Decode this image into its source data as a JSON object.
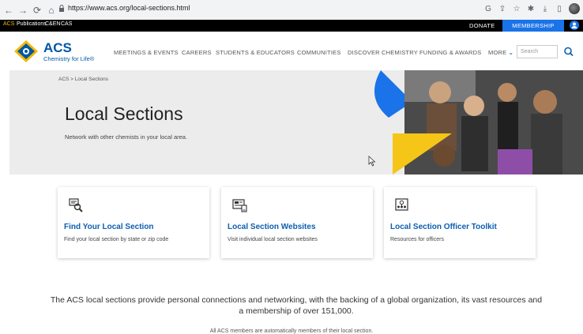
{
  "browser": {
    "url": "https://www.acs.org/local-sections.html"
  },
  "utility_bar": {
    "links": [
      "ACS",
      "Publications",
      "C&EN",
      "CAS"
    ],
    "donate": "DONATE",
    "membership": "MEMBERSHIP"
  },
  "header": {
    "logo_title": "ACS",
    "logo_tagline": "Chemistry for Life®",
    "nav": [
      "MEETINGS & EVENTS",
      "CAREERS",
      "STUDENTS & EDUCATORS",
      "COMMUNITIES",
      "DISCOVER CHEMISTRY",
      "FUNDING & AWARDS",
      "MORE"
    ],
    "search_placeholder": "Search"
  },
  "hero": {
    "breadcrumb": "ACS  >  Local Sections",
    "title": "Local Sections",
    "subtitle": "Network with other chemists in your local area."
  },
  "cards": [
    {
      "title": "Find Your Local Section",
      "desc": "Find your local section by state or zip code",
      "icon": "magnifier-document-icon"
    },
    {
      "title": "Local Section Websites",
      "desc": "Visit individual local section websites",
      "icon": "website-icon"
    },
    {
      "title": "Local Section Officer Toolkit",
      "desc": "Resources for officers",
      "icon": "toolkit-icon"
    }
  ],
  "body": {
    "lead": "The ACS local sections provide personal connections and networking, with the backing of a global organization, its vast resources and a membership of over 151,000.",
    "note": "All ACS members are automatically members of their local section."
  },
  "colors": {
    "accent_blue": "#1a73e8",
    "link_blue": "#0b5fb0",
    "brand_blue": "#0057a4",
    "brand_gold": "#f5b800"
  }
}
